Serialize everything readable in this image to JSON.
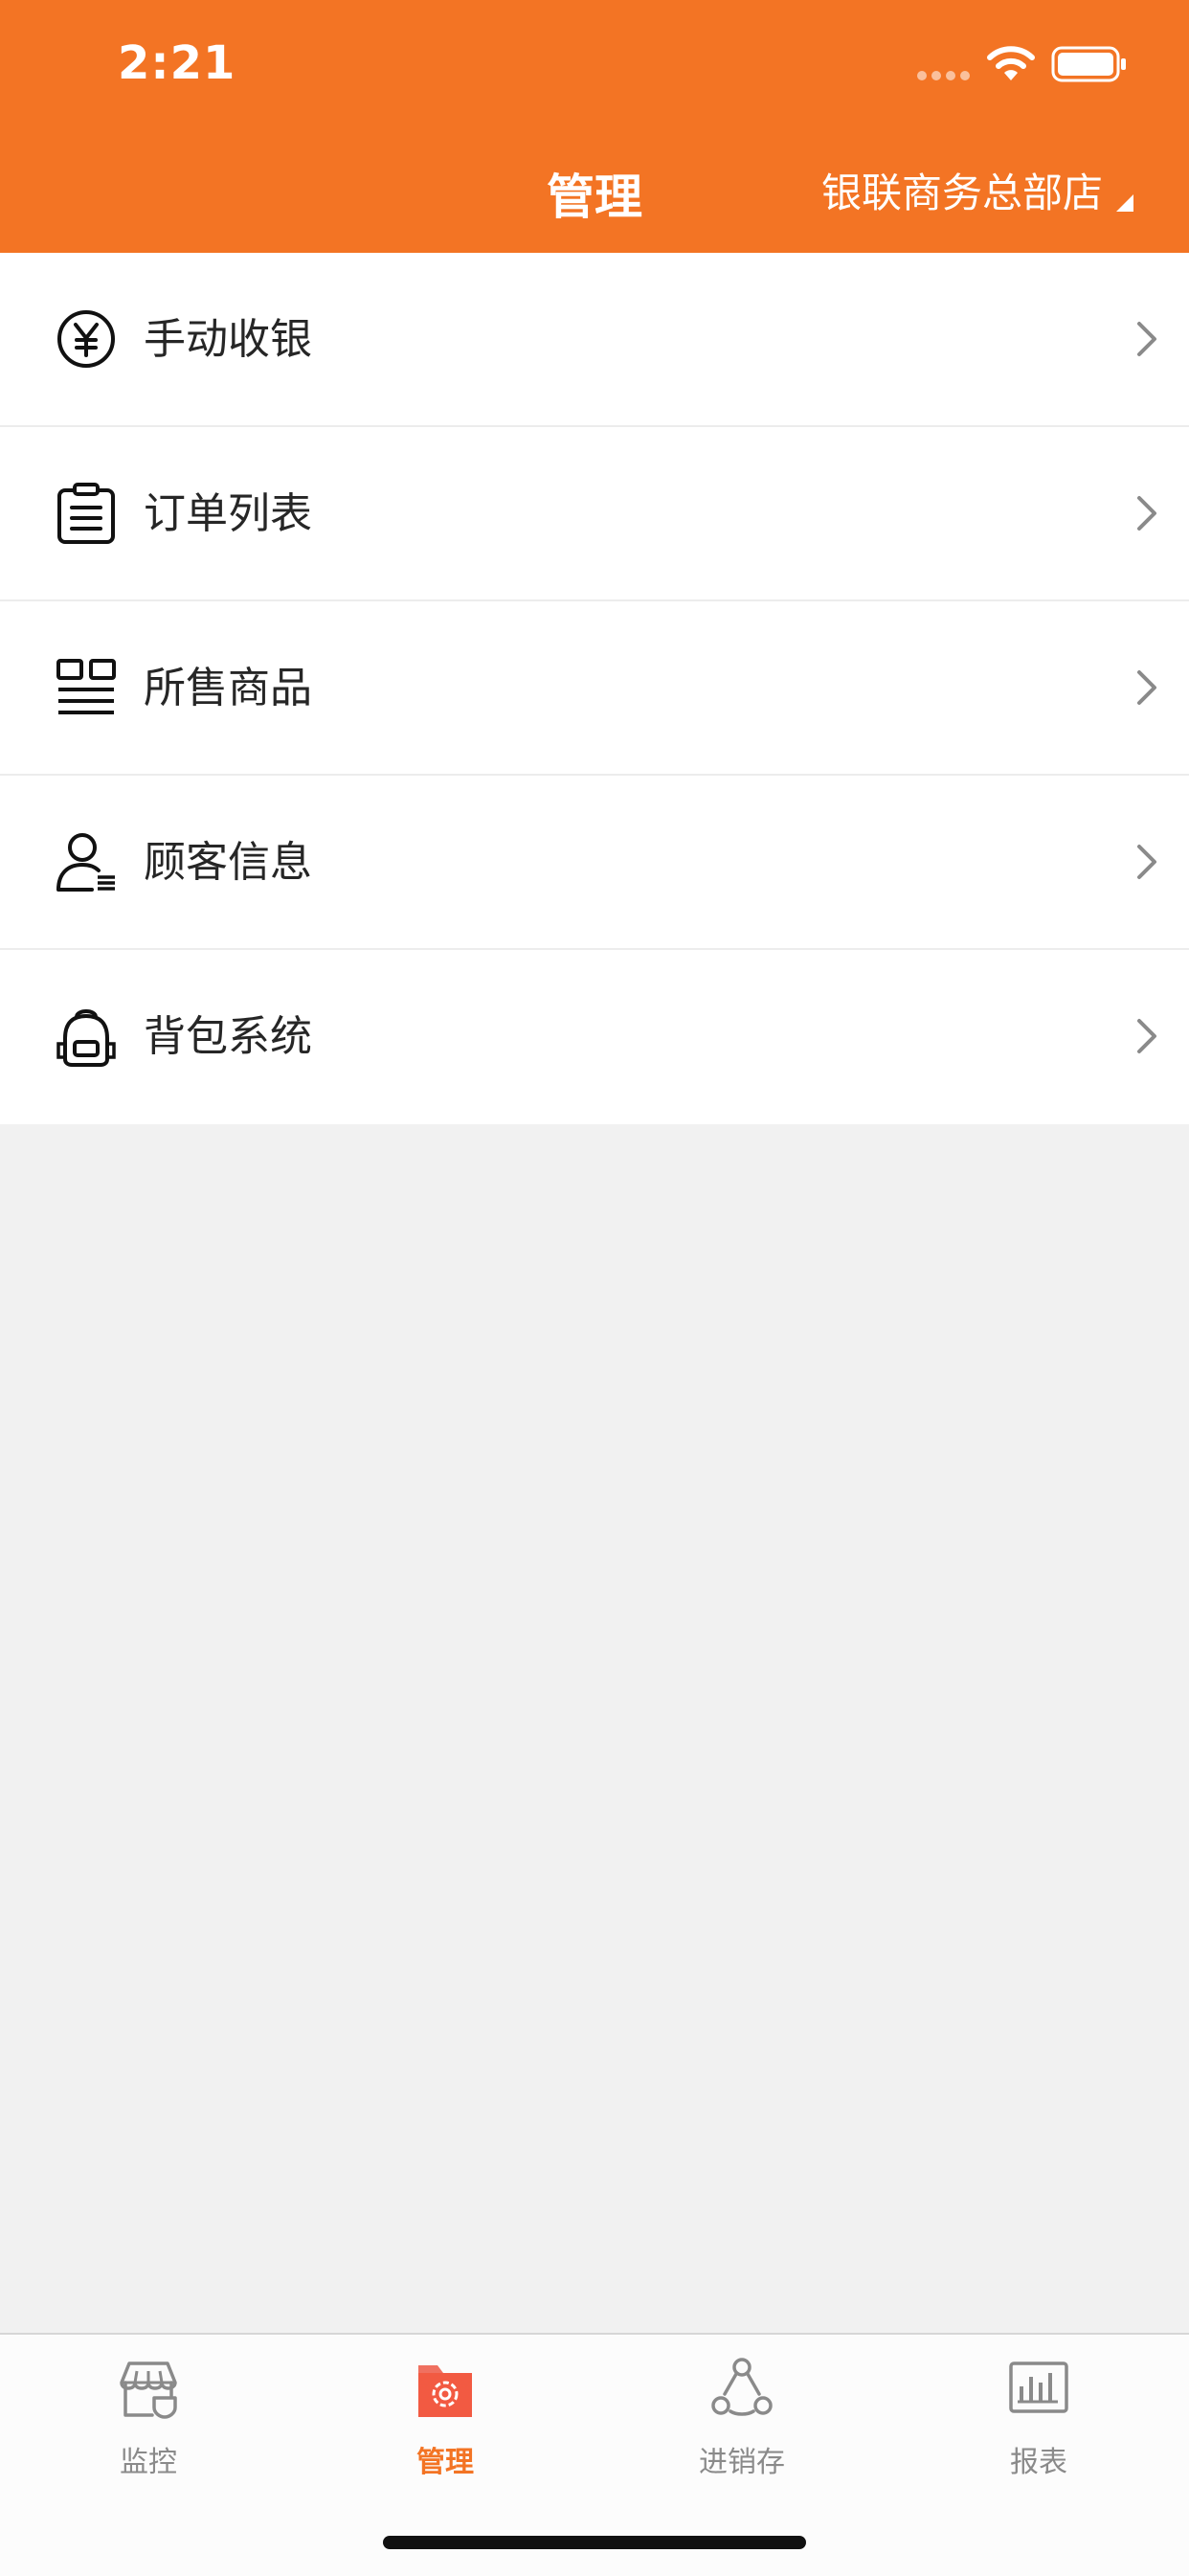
{
  "status_bar": {
    "time": "2:21"
  },
  "header": {
    "title": "管理",
    "store_name": "银联商务总部店"
  },
  "menu": [
    {
      "label": "手动收银",
      "icon": "yen-icon"
    },
    {
      "label": "订单列表",
      "icon": "clipboard-list-icon"
    },
    {
      "label": "所售商品",
      "icon": "product-grid-icon"
    },
    {
      "label": "顾客信息",
      "icon": "customer-icon"
    },
    {
      "label": "背包系统",
      "icon": "backpack-icon"
    }
  ],
  "tabs": [
    {
      "label": "监控",
      "icon": "store-icon",
      "active": false
    },
    {
      "label": "管理",
      "icon": "settings-folder-icon",
      "active": true
    },
    {
      "label": "进销存",
      "icon": "inventory-icon",
      "active": false
    },
    {
      "label": "报表",
      "icon": "report-chart-icon",
      "active": false
    }
  ],
  "colors": {
    "brand": "#f37424",
    "background": "#f1f1f1",
    "inactive_tab": "#8a8a8a"
  }
}
